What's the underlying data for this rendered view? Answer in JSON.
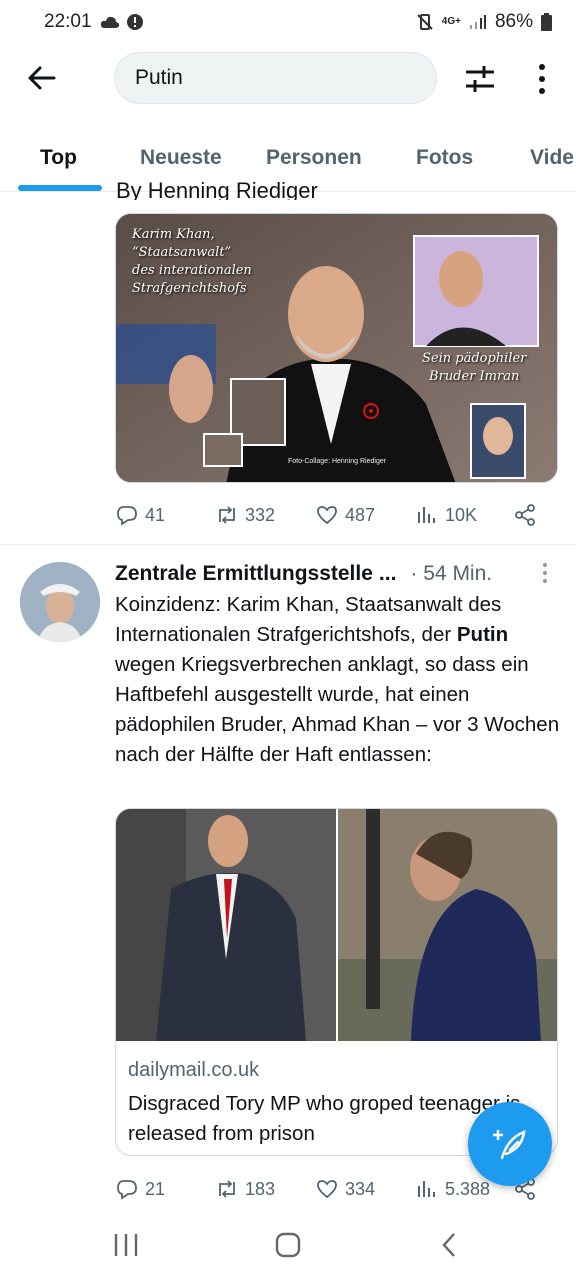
{
  "status_bar": {
    "time": "22:01",
    "network_label": "4G+",
    "battery": "86%"
  },
  "search": {
    "query": "Putin"
  },
  "tabs": [
    {
      "label": "Top",
      "active": true
    },
    {
      "label": "Neueste",
      "active": false
    },
    {
      "label": "Personen",
      "active": false
    },
    {
      "label": "Fotos",
      "active": false
    },
    {
      "label": "Vide",
      "active": false
    }
  ],
  "tweet1": {
    "byline_partial": "By Henning Riediger",
    "media_overlay": {
      "caption_left": [
        "Karim Khan,",
        "“Staatsanwalt”",
        "des interationalen",
        "Strafgerichtshofs"
      ],
      "caption_right": [
        "Sein pädophiler",
        "Bruder Imran"
      ],
      "credit": "Foto-Collage: Henning Riediger"
    },
    "actions": {
      "replies": "41",
      "retweets": "332",
      "likes": "487",
      "views": "10K"
    }
  },
  "tweet2": {
    "author": "Zentrale Ermittlungsstelle",
    "ellipsis": "...",
    "time": "· 54 Min.",
    "text_before": "Koinzidenz: Karim Khan, Staatsanwalt des Internationalen Strafgerichtshofs, der ",
    "text_highlight": "Putin",
    "text_after": " wegen Kriegsverbrechen anklagt, so dass ein Haftbefehl ausgestellt wurde, hat einen pädophilen Bruder, Ahmad Khan – vor 3 Wochen nach der Hälfte der Haft entlassen:",
    "card": {
      "domain": "dailymail.co.uk",
      "title": "Disgraced Tory MP who groped teenager is released from prison"
    },
    "actions": {
      "replies": "21",
      "retweets": "183",
      "likes": "334",
      "views": "5.388"
    }
  },
  "colors": {
    "accent": "#1d9bf0",
    "text_primary": "#0f1419",
    "text_secondary": "#536471"
  }
}
